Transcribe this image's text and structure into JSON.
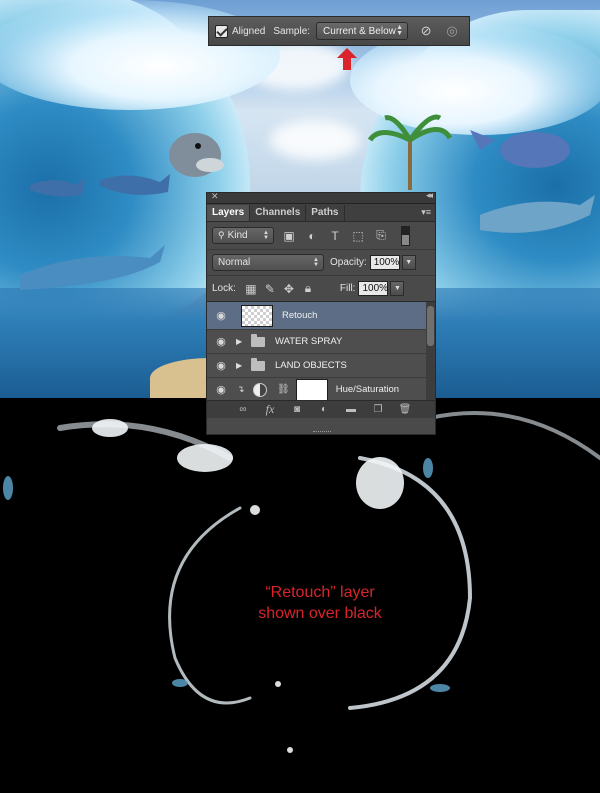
{
  "options_bar": {
    "aligned_checked": true,
    "aligned_label": "Aligned",
    "sample_label": "Sample:",
    "sample_value": "Current & Below",
    "icons": [
      "ignore-adjustment-layers-icon",
      "pressure-size-icon"
    ]
  },
  "layers_panel": {
    "tabs": [
      {
        "label": "Layers",
        "active": true
      },
      {
        "label": "Channels",
        "active": false
      },
      {
        "label": "Paths",
        "active": false
      }
    ],
    "filter_kind": "Kind",
    "blend_mode": "Normal",
    "opacity_label": "Opacity:",
    "opacity_value": "100%",
    "lock_label": "Lock:",
    "fill_label": "Fill:",
    "fill_value": "100%",
    "layers": [
      {
        "name": "Retouch",
        "type": "pixel",
        "visible": true,
        "selected": true
      },
      {
        "name": "WATER SPRAY",
        "type": "group",
        "visible": true,
        "selected": false
      },
      {
        "name": "LAND OBJECTS",
        "type": "group",
        "visible": true,
        "selected": false
      },
      {
        "name": "Hue/Saturation",
        "type": "adjustment",
        "visible": true,
        "selected": false,
        "clipped": true
      }
    ]
  },
  "caption": {
    "line1": "“Retouch” layer",
    "line2": "shown over black"
  },
  "colors": {
    "caption": "#d8242a",
    "arrow": "#d8242a",
    "selected_layer": "#5d6d86",
    "panel_bg": "#4a4a4a"
  }
}
